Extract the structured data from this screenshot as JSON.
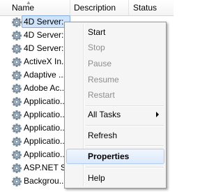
{
  "columns": {
    "name": "Name",
    "description": "Description",
    "status": "Status"
  },
  "services": [
    {
      "name": "4D Server: ..."
    },
    {
      "name": "4D Server: ..."
    },
    {
      "name": "4D Server: ..."
    },
    {
      "name": "ActiveX In..."
    },
    {
      "name": "Adaptive ..."
    },
    {
      "name": "Adobe Ac..."
    },
    {
      "name": "Applicatio..."
    },
    {
      "name": "Applicatio..."
    },
    {
      "name": "Applicatio..."
    },
    {
      "name": "Applicatio..."
    },
    {
      "name": "Applicatio..."
    },
    {
      "name": "ASP.NET S..."
    },
    {
      "name": "Backgrou..."
    }
  ],
  "context_menu": {
    "start": "Start",
    "stop": "Stop",
    "pause": "Pause",
    "resume": "Resume",
    "restart": "Restart",
    "all_tasks": "All Tasks",
    "refresh": "Refresh",
    "properties": "Properties",
    "help": "Help"
  },
  "colors": {
    "selection": "#cfe3fc",
    "hover_border": "#aeccf1",
    "disabled_text": "#8d8d8d"
  },
  "icons": {
    "service": "gear-icon",
    "submenu": "submenu-arrow-icon",
    "sort": "sort-ascending-icon"
  }
}
